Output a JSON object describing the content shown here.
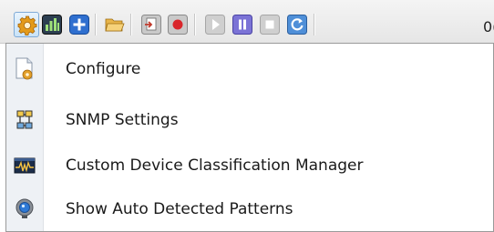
{
  "toolbar": {
    "buttons": [
      {
        "icon": "gear-icon",
        "state": "active"
      },
      {
        "icon": "bar-chart-icon"
      },
      {
        "icon": "plus-icon"
      },
      {
        "icon": "open-folder-icon"
      },
      {
        "icon": "export-icon"
      },
      {
        "icon": "record-icon"
      },
      {
        "icon": "play-icon",
        "state": "disabled"
      },
      {
        "icon": "pause-icon"
      },
      {
        "icon": "stop-icon",
        "state": "disabled"
      },
      {
        "icon": "refresh-icon"
      }
    ],
    "trailing_text": "0("
  },
  "menu": {
    "items": [
      {
        "label": "Configure",
        "icon": "document-gear-icon"
      },
      {
        "label": "SNMP Settings",
        "icon": "network-devices-icon"
      },
      {
        "label": "Custom Device Classification Manager",
        "icon": "signal-monitor-icon"
      },
      {
        "label": "Show Auto Detected Patterns",
        "icon": "globe-lens-icon"
      }
    ]
  },
  "colors": {
    "accent_blue": "#2f6fcf",
    "active_border": "#7faad6",
    "menu_gutter": "#eef1f5"
  }
}
